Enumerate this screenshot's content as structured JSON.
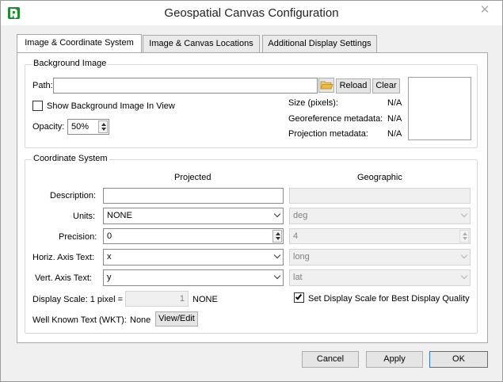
{
  "window": {
    "title": "Geospatial Canvas Configuration",
    "close_glyph": "✕"
  },
  "tabs": [
    {
      "label": "Image & Coordinate System",
      "active": true
    },
    {
      "label": "Image & Canvas Locations",
      "active": false
    },
    {
      "label": "Additional Display Settings",
      "active": false
    }
  ],
  "background_image": {
    "group_title": "Background Image",
    "path_label": "Path:",
    "path_value": "",
    "reload_label": "Reload",
    "clear_label": "Clear",
    "show_checkbox_label": "Show Background Image In View",
    "show_checked": false,
    "opacity_label": "Opacity:",
    "opacity_value": "50%",
    "size_label": "Size (pixels):",
    "size_value": "N/A",
    "georef_label": "Georeference metadata:",
    "georef_value": "N/A",
    "projection_label": "Projection metadata:",
    "projection_value": "N/A"
  },
  "coordinate_system": {
    "group_title": "Coordinate System",
    "projected_header": "Projected",
    "geographic_header": "Geographic",
    "rows": {
      "description": {
        "label": "Description:",
        "projected": "",
        "geographic": ""
      },
      "units": {
        "label": "Units:",
        "projected": "NONE",
        "geographic": "deg"
      },
      "precision": {
        "label": "Precision:",
        "projected": "0",
        "geographic": "4"
      },
      "horiz_axis": {
        "label": "Horiz. Axis Text:",
        "projected": "x",
        "geographic": "long"
      },
      "vert_axis": {
        "label": "Vert. Axis Text:",
        "projected": "y",
        "geographic": "lat"
      }
    },
    "display_scale_label": "Display Scale: 1 pixel =",
    "display_scale_value": "1",
    "display_scale_unit": "NONE",
    "best_scale_label": "Set  Display Scale for Best Display Quality",
    "best_scale_checked": true,
    "wkt_label": "Well Known Text (WKT):",
    "wkt_value": "None",
    "wkt_button": "View/Edit"
  },
  "footer": {
    "cancel_label": "Cancel",
    "apply_label": "Apply",
    "ok_label": "OK"
  },
  "colors": {
    "accent": "#2b78d4",
    "app_icon": "#1e8a32",
    "folder": "#e8b84a"
  }
}
